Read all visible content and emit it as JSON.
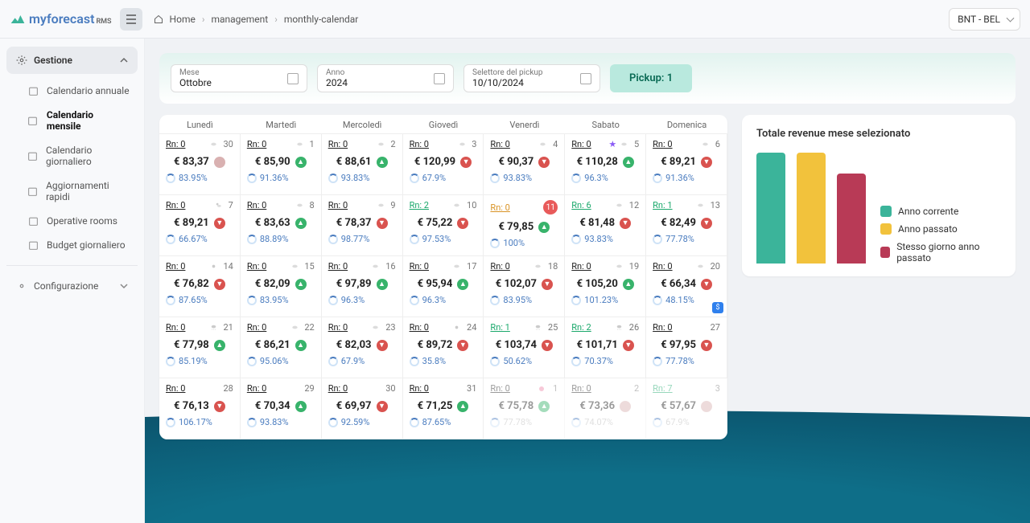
{
  "brand": {
    "name": "myforecast",
    "suffix": "RMS"
  },
  "breadcrumb": {
    "home": "Home",
    "b1": "management",
    "b2": "monthly-calendar"
  },
  "org": "BNT - BEL",
  "sidebar": {
    "group": "Gestione",
    "items": [
      {
        "label": "Calendario annuale"
      },
      {
        "label": "Calendario mensile"
      },
      {
        "label": "Calendario giornaliero"
      },
      {
        "label": "Aggiornamenti rapidi"
      },
      {
        "label": "Operative rooms"
      },
      {
        "label": "Budget giornaliero"
      }
    ],
    "config": "Configurazione"
  },
  "filters": {
    "month_label": "Mese",
    "month_value": "Ottobre",
    "year_label": "Anno",
    "year_value": "2024",
    "pickup_label": "Selettore del pickup",
    "pickup_value": "10/10/2024",
    "pickup_badge": "Pickup: 1"
  },
  "days": [
    "Lunedì",
    "Martedì",
    "Mercoledì",
    "Giovedì",
    "Venerdì",
    "Sabato",
    "Domenica"
  ],
  "revenue": {
    "title": "Totale revenue mese selezionato",
    "legend": [
      "Anno corrente",
      "Anno passato",
      "Stesso giorno anno passato"
    ],
    "colors": [
      "#3bb49a",
      "#f2c23c",
      "#b83a56"
    ]
  },
  "chart_data": {
    "type": "bar",
    "categories": [
      "Anno corrente",
      "Anno passato",
      "Stesso giorno anno passato"
    ],
    "values": [
      138,
      138,
      112
    ],
    "title": "Totale revenue mese selezionato",
    "xlabel": "",
    "ylabel": "",
    "ylim": [
      0,
      140
    ]
  },
  "cells": [
    [
      {
        "rn": "Rn: 0",
        "rn_c": "",
        "day": "30",
        "price": "€ 83,37",
        "ind": "neutral",
        "occ": "83.95%",
        "w": "cloud",
        "faded": false
      },
      {
        "rn": "Rn: 0",
        "rn_c": "",
        "day": "1",
        "price": "€ 85,90",
        "ind": "up",
        "occ": "91.36%",
        "w": "cloud"
      },
      {
        "rn": "Rn: 0",
        "rn_c": "",
        "day": "2",
        "price": "€ 88,61",
        "ind": "up",
        "occ": "93.83%",
        "w": "cloud"
      },
      {
        "rn": "Rn: 0",
        "rn_c": "",
        "day": "3",
        "price": "€ 120,99",
        "ind": "down",
        "occ": "67.9%",
        "w": "cloud"
      },
      {
        "rn": "Rn: 0",
        "rn_c": "",
        "day": "4",
        "price": "€ 90,37",
        "ind": "down",
        "occ": "93.83%",
        "w": "cloud"
      },
      {
        "rn": "Rn: 0",
        "rn_c": "",
        "day": "5",
        "price": "€ 110,28",
        "ind": "up",
        "occ": "96.3%",
        "w": "cloud",
        "star": true
      },
      {
        "rn": "Rn: 0",
        "rn_c": "",
        "day": "6",
        "price": "€ 89,21",
        "ind": "down",
        "occ": "91.36%",
        "w": "cloud"
      }
    ],
    [
      {
        "rn": "Rn: 0",
        "rn_c": "",
        "day": "7",
        "price": "€ 89,21",
        "ind": "down",
        "occ": "66.67%",
        "w": "partly"
      },
      {
        "rn": "Rn: 0",
        "rn_c": "",
        "day": "8",
        "price": "€ 83,63",
        "ind": "up",
        "occ": "88.89%",
        "w": "cloud"
      },
      {
        "rn": "Rn: 0",
        "rn_c": "",
        "day": "9",
        "price": "€ 78,37",
        "ind": "down",
        "occ": "98.77%",
        "w": "cloud"
      },
      {
        "rn": "Rn: 2",
        "rn_c": "green",
        "day": "10",
        "price": "€ 75,22",
        "ind": "down",
        "occ": "97.53%",
        "w": "cloud"
      },
      {
        "rn": "Rn: 0",
        "rn_c": "orange",
        "day": "11",
        "price": "€ 79,85",
        "ind": "up",
        "occ": "100%",
        "w": "sun",
        "circle": true
      },
      {
        "rn": "Rn: 6",
        "rn_c": "green",
        "day": "12",
        "price": "€ 81,48",
        "ind": "down",
        "occ": "93.83%",
        "w": "cloud"
      },
      {
        "rn": "Rn: 1",
        "rn_c": "green",
        "day": "13",
        "price": "€ 82,49",
        "ind": "down",
        "occ": "77.78%",
        "w": "cloud"
      }
    ],
    [
      {
        "rn": "Rn: 0",
        "rn_c": "",
        "day": "14",
        "price": "€ 76,82",
        "ind": "down",
        "occ": "87.65%",
        "w": "sun"
      },
      {
        "rn": "Rn: 0",
        "rn_c": "",
        "day": "15",
        "price": "€ 82,09",
        "ind": "up",
        "occ": "83.95%",
        "w": "cloud"
      },
      {
        "rn": "Rn: 0",
        "rn_c": "",
        "day": "16",
        "price": "€ 97,89",
        "ind": "up",
        "occ": "96.3%",
        "w": "cloud"
      },
      {
        "rn": "Rn: 0",
        "rn_c": "",
        "day": "17",
        "price": "€ 95,94",
        "ind": "up",
        "occ": "96.3%",
        "w": "cloud"
      },
      {
        "rn": "Rn: 0",
        "rn_c": "",
        "day": "18",
        "price": "€ 102,07",
        "ind": "down",
        "occ": "83.95%",
        "w": "cloud"
      },
      {
        "rn": "Rn: 0",
        "rn_c": "",
        "day": "19",
        "price": "€ 105,20",
        "ind": "up",
        "occ": "101.23%",
        "w": "cloud"
      },
      {
        "rn": "Rn: 0",
        "rn_c": "",
        "day": "20",
        "price": "€ 66,34",
        "ind": "down",
        "occ": "48.15%",
        "w": "cloud",
        "dollar": true
      }
    ],
    [
      {
        "rn": "Rn: 0",
        "rn_c": "",
        "day": "21",
        "price": "€ 77,98",
        "ind": "up",
        "occ": "85.19%",
        "w": "rain"
      },
      {
        "rn": "Rn: 0",
        "rn_c": "",
        "day": "22",
        "price": "€ 86,21",
        "ind": "up",
        "occ": "95.06%",
        "w": "cloud"
      },
      {
        "rn": "Rn: 0",
        "rn_c": "",
        "day": "23",
        "price": "€ 82,03",
        "ind": "down",
        "occ": "67.9%",
        "w": "cloud"
      },
      {
        "rn": "Rn: 0",
        "rn_c": "",
        "day": "24",
        "price": "€ 89,72",
        "ind": "down",
        "occ": "35.8%",
        "w": "sun"
      },
      {
        "rn": "Rn: 1",
        "rn_c": "green",
        "day": "25",
        "price": "€ 103,74",
        "ind": "down",
        "occ": "50.62%",
        "w": "rain"
      },
      {
        "rn": "Rn: 2",
        "rn_c": "green",
        "day": "26",
        "price": "€ 101,71",
        "ind": "down",
        "occ": "70.37%",
        "w": "rain"
      },
      {
        "rn": "Rn: 0",
        "rn_c": "",
        "day": "27",
        "price": "€ 97,95",
        "ind": "down",
        "occ": "77.78%",
        "w": ""
      }
    ],
    [
      {
        "rn": "Rn: 0",
        "rn_c": "",
        "day": "28",
        "price": "€ 76,13",
        "ind": "down",
        "occ": "106.17%",
        "w": ""
      },
      {
        "rn": "Rn: 0",
        "rn_c": "",
        "day": "29",
        "price": "€ 70,34",
        "ind": "up",
        "occ": "93.83%",
        "w": ""
      },
      {
        "rn": "Rn: 0",
        "rn_c": "",
        "day": "30",
        "price": "€ 69,97",
        "ind": "down",
        "occ": "92.59%",
        "w": ""
      },
      {
        "rn": "Rn: 0",
        "rn_c": "",
        "day": "31",
        "price": "€ 71,25",
        "ind": "up",
        "occ": "87.65%",
        "w": ""
      },
      {
        "rn": "Rn: 0",
        "rn_c": "",
        "day": "1",
        "price": "€ 75,78",
        "ind": "up",
        "occ": "77.78%",
        "w": "",
        "faded": true,
        "dot": true
      },
      {
        "rn": "Rn: 0",
        "rn_c": "",
        "day": "2",
        "price": "€ 73,36",
        "ind": "neutral",
        "occ": "74.07%",
        "w": "",
        "faded": true
      },
      {
        "rn": "Rn: 7",
        "rn_c": "green",
        "day": "3",
        "price": "€ 57,67",
        "ind": "neutral",
        "occ": "67.9%",
        "w": "",
        "faded": true
      }
    ]
  ]
}
